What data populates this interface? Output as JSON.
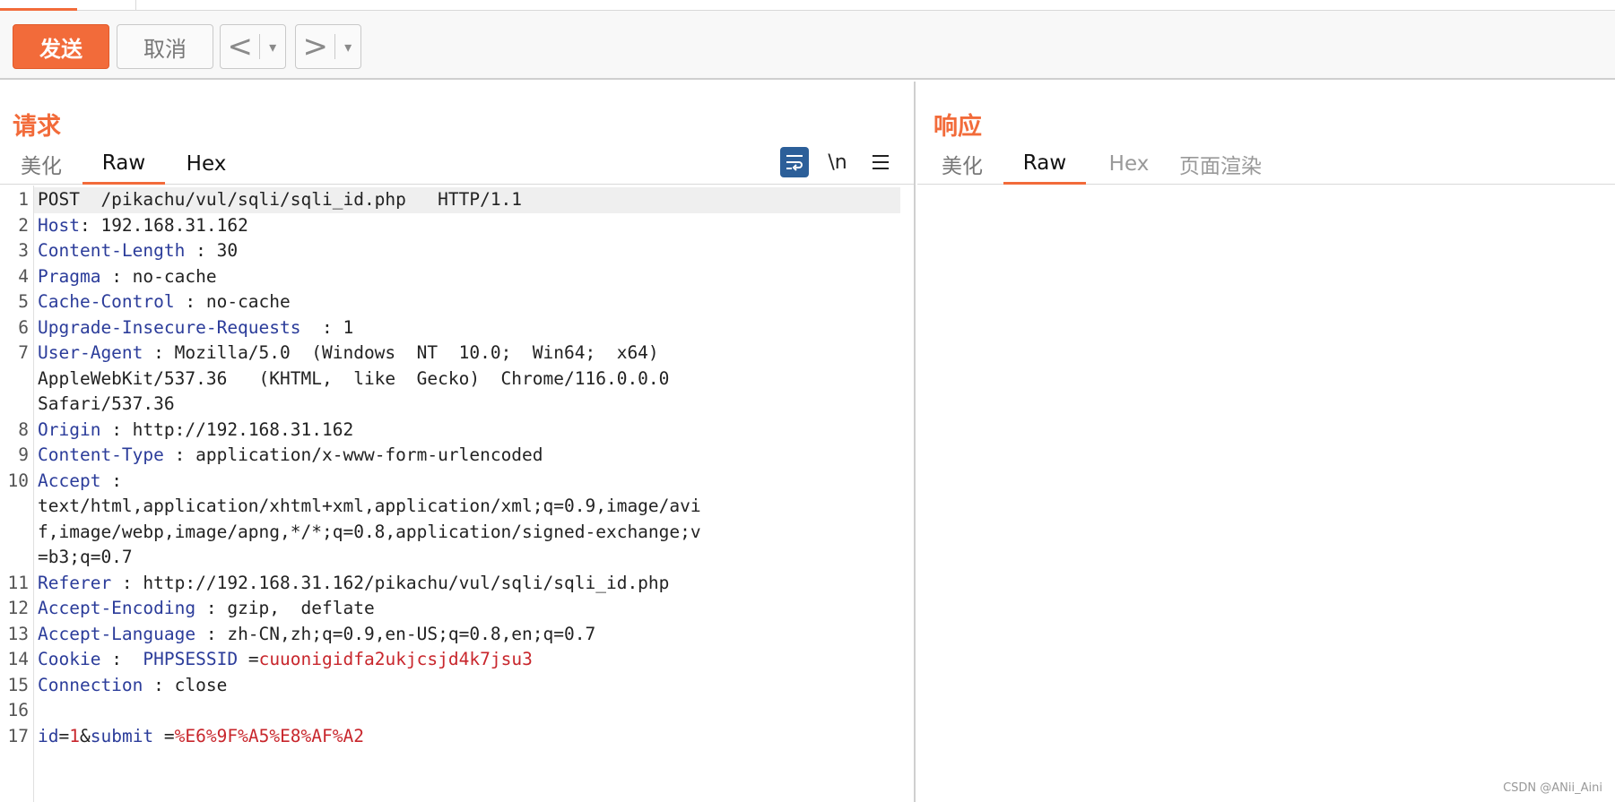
{
  "toolbar": {
    "send_label": "发送",
    "cancel_label": "取消",
    "back_label": "<",
    "forward_label": ">",
    "dropdown_glyph": "▾"
  },
  "request": {
    "title": "请求",
    "tabs": [
      "美化",
      "Raw",
      "Hex"
    ],
    "active_tab": "Raw",
    "tools": {
      "wrap_icon": "wrap-lines-icon",
      "newline_label": "\\n",
      "menu_icon": "hamburger-menu-icon"
    },
    "lines": [
      {
        "n": "1",
        "parts": [
          {
            "t": "POST  /pikachu/vul/sqli/sqli_id.php   HTTP/1.1",
            "c": "v"
          }
        ]
      },
      {
        "n": "2",
        "parts": [
          {
            "t": "Host",
            "c": "k"
          },
          {
            "t": ": 192.168.31.162",
            "c": "v"
          }
        ]
      },
      {
        "n": "3",
        "parts": [
          {
            "t": "Content-Length",
            "c": "k"
          },
          {
            "t": " : 30",
            "c": "v"
          }
        ]
      },
      {
        "n": "4",
        "parts": [
          {
            "t": "Pragma",
            "c": "k"
          },
          {
            "t": " : no-cache",
            "c": "v"
          }
        ]
      },
      {
        "n": "5",
        "parts": [
          {
            "t": "Cache-Control",
            "c": "k"
          },
          {
            "t": " : no-cache",
            "c": "v"
          }
        ]
      },
      {
        "n": "6",
        "parts": [
          {
            "t": "Upgrade-Insecure-Requests",
            "c": "k"
          },
          {
            "t": "  : 1",
            "c": "v"
          }
        ]
      },
      {
        "n": "7",
        "parts": [
          {
            "t": "User-Agent",
            "c": "k"
          },
          {
            "t": " : Mozilla/5.0  (Windows  NT  10.0;  Win64;  x64)",
            "c": "v"
          }
        ]
      },
      {
        "n": "",
        "parts": [
          {
            "t": "AppleWebKit/537.36   (KHTML,  like  Gecko)  Chrome/116.0.0.0",
            "c": "v"
          }
        ]
      },
      {
        "n": "",
        "parts": [
          {
            "t": "Safari/537.36",
            "c": "v"
          }
        ]
      },
      {
        "n": "8",
        "parts": [
          {
            "t": "Origin",
            "c": "k"
          },
          {
            "t": " : http://192.168.31.162",
            "c": "v"
          }
        ]
      },
      {
        "n": "9",
        "parts": [
          {
            "t": "Content-Type",
            "c": "k"
          },
          {
            "t": " : application/x-www-form-urlencoded",
            "c": "v"
          }
        ]
      },
      {
        "n": "10",
        "parts": [
          {
            "t": "Accept",
            "c": "k"
          },
          {
            "t": " :",
            "c": "v"
          }
        ]
      },
      {
        "n": "",
        "parts": [
          {
            "t": "text/html,application/xhtml+xml,application/xml;q=0.9,image/avi",
            "c": "v"
          }
        ]
      },
      {
        "n": "",
        "parts": [
          {
            "t": "f,image/webp,image/apng,*/*;q=0.8,application/signed-exchange;v",
            "c": "v"
          }
        ]
      },
      {
        "n": "",
        "parts": [
          {
            "t": "=b3;q=0.7",
            "c": "v"
          }
        ]
      },
      {
        "n": "11",
        "parts": [
          {
            "t": "Referer",
            "c": "k"
          },
          {
            "t": " : http://192.168.31.162/pikachu/vul/sqli/sqli_id.php",
            "c": "v"
          }
        ]
      },
      {
        "n": "12",
        "parts": [
          {
            "t": "Accept-Encoding",
            "c": "k"
          },
          {
            "t": " : gzip,  deflate",
            "c": "v"
          }
        ]
      },
      {
        "n": "13",
        "parts": [
          {
            "t": "Accept-Language",
            "c": "k"
          },
          {
            "t": " : zh-CN,zh;q=0.9,en-US;q=0.8,en;q=0.7",
            "c": "v"
          }
        ]
      },
      {
        "n": "14",
        "parts": [
          {
            "t": "Cookie",
            "c": "k"
          },
          {
            "t": " :  ",
            "c": "v"
          },
          {
            "t": "PHPSESSID",
            "c": "k"
          },
          {
            "t": " =",
            "c": "v"
          },
          {
            "t": "cuuonigidfa2ukjcsjd4k7jsu3",
            "c": "r"
          }
        ]
      },
      {
        "n": "15",
        "parts": [
          {
            "t": "Connection",
            "c": "k"
          },
          {
            "t": " : close",
            "c": "v"
          }
        ]
      },
      {
        "n": "16",
        "parts": [
          {
            "t": "",
            "c": "v"
          }
        ]
      },
      {
        "n": "17",
        "parts": [
          {
            "t": "id",
            "c": "k"
          },
          {
            "t": "=",
            "c": "v"
          },
          {
            "t": "1",
            "c": "r"
          },
          {
            "t": "&",
            "c": "v"
          },
          {
            "t": "submit",
            "c": "k"
          },
          {
            "t": " =",
            "c": "v"
          },
          {
            "t": "%E6%9F%A5%E8%AF%A2",
            "c": "r"
          }
        ]
      }
    ]
  },
  "response": {
    "title": "响应",
    "tabs": [
      "美化",
      "Raw",
      "Hex",
      "页面渲染"
    ],
    "active_tab": "Raw"
  },
  "watermark": "CSDN @ANii_Aini",
  "colors": {
    "accent": "#f26b3a",
    "key": "#2b3c9a",
    "value_red": "#c8262c",
    "wrap_icon_bg": "#2c5f99"
  }
}
